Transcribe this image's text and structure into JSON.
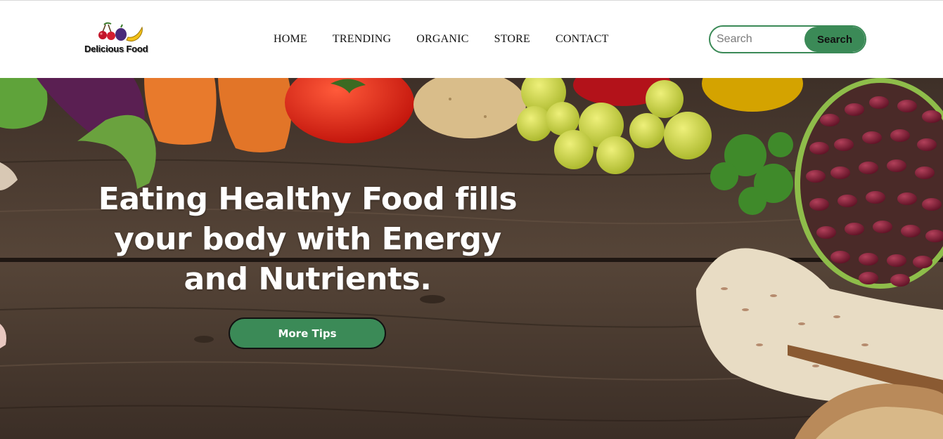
{
  "brand": {
    "name": "Delicious Food",
    "logo_icon": "fruit-logo-icon"
  },
  "nav": {
    "items": [
      "HOME",
      "TRENDING",
      "ORGANIC",
      "STORE",
      "CONTACT"
    ]
  },
  "search": {
    "placeholder": "Search",
    "value": "",
    "button_label": "Search"
  },
  "hero": {
    "heading": "Eating Healthy Food fills your body with Energy and Nutrients.",
    "button_label": "More Tips",
    "background": "wooden-table-with-vegetables-image"
  },
  "colors": {
    "accent": "#3b8a57",
    "text": "#111111",
    "hero_text": "#ffffff"
  }
}
